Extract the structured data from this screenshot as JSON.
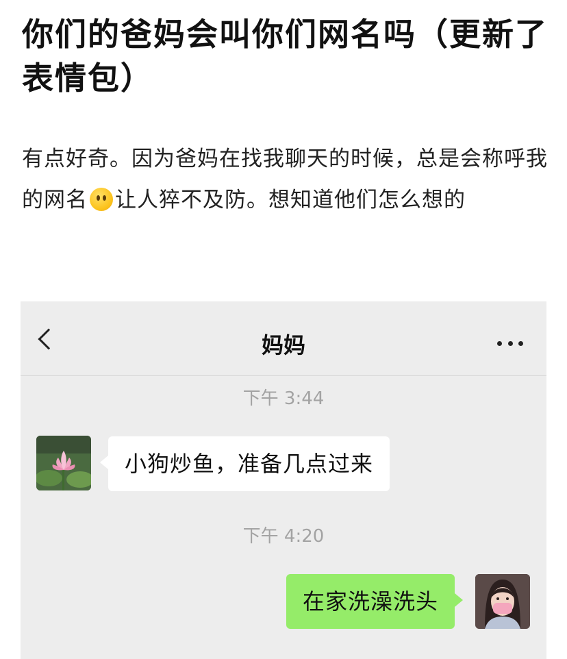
{
  "post": {
    "title": "你们的爸妈会叫你们网名吗（更新了表情包）",
    "body_before_emoji": "有点好奇。因为爸妈在找我聊天的时候，总是会称呼我的网名",
    "body_after_emoji": "让人猝不及防。想知道他们怎么想的",
    "emoji_icon": "face-without-mouth-icon"
  },
  "chat": {
    "contact_name": "妈妈",
    "back_icon": "chevron-left-icon",
    "more_icon": "more-dots-icon",
    "messages": [
      {
        "timestamp": "下午 3:44",
        "sender": "contact",
        "text": "小狗炒鱼，准备几点过来",
        "avatar": "lotus-avatar"
      },
      {
        "timestamp": "下午 4:20",
        "sender": "me",
        "text": "在家洗澡洗头",
        "avatar": "girl-selfie-avatar"
      }
    ],
    "colors": {
      "background": "#ededed",
      "incoming_bubble": "#ffffff",
      "outgoing_bubble": "#95ec69",
      "timestamp": "#a3a3a3"
    }
  }
}
